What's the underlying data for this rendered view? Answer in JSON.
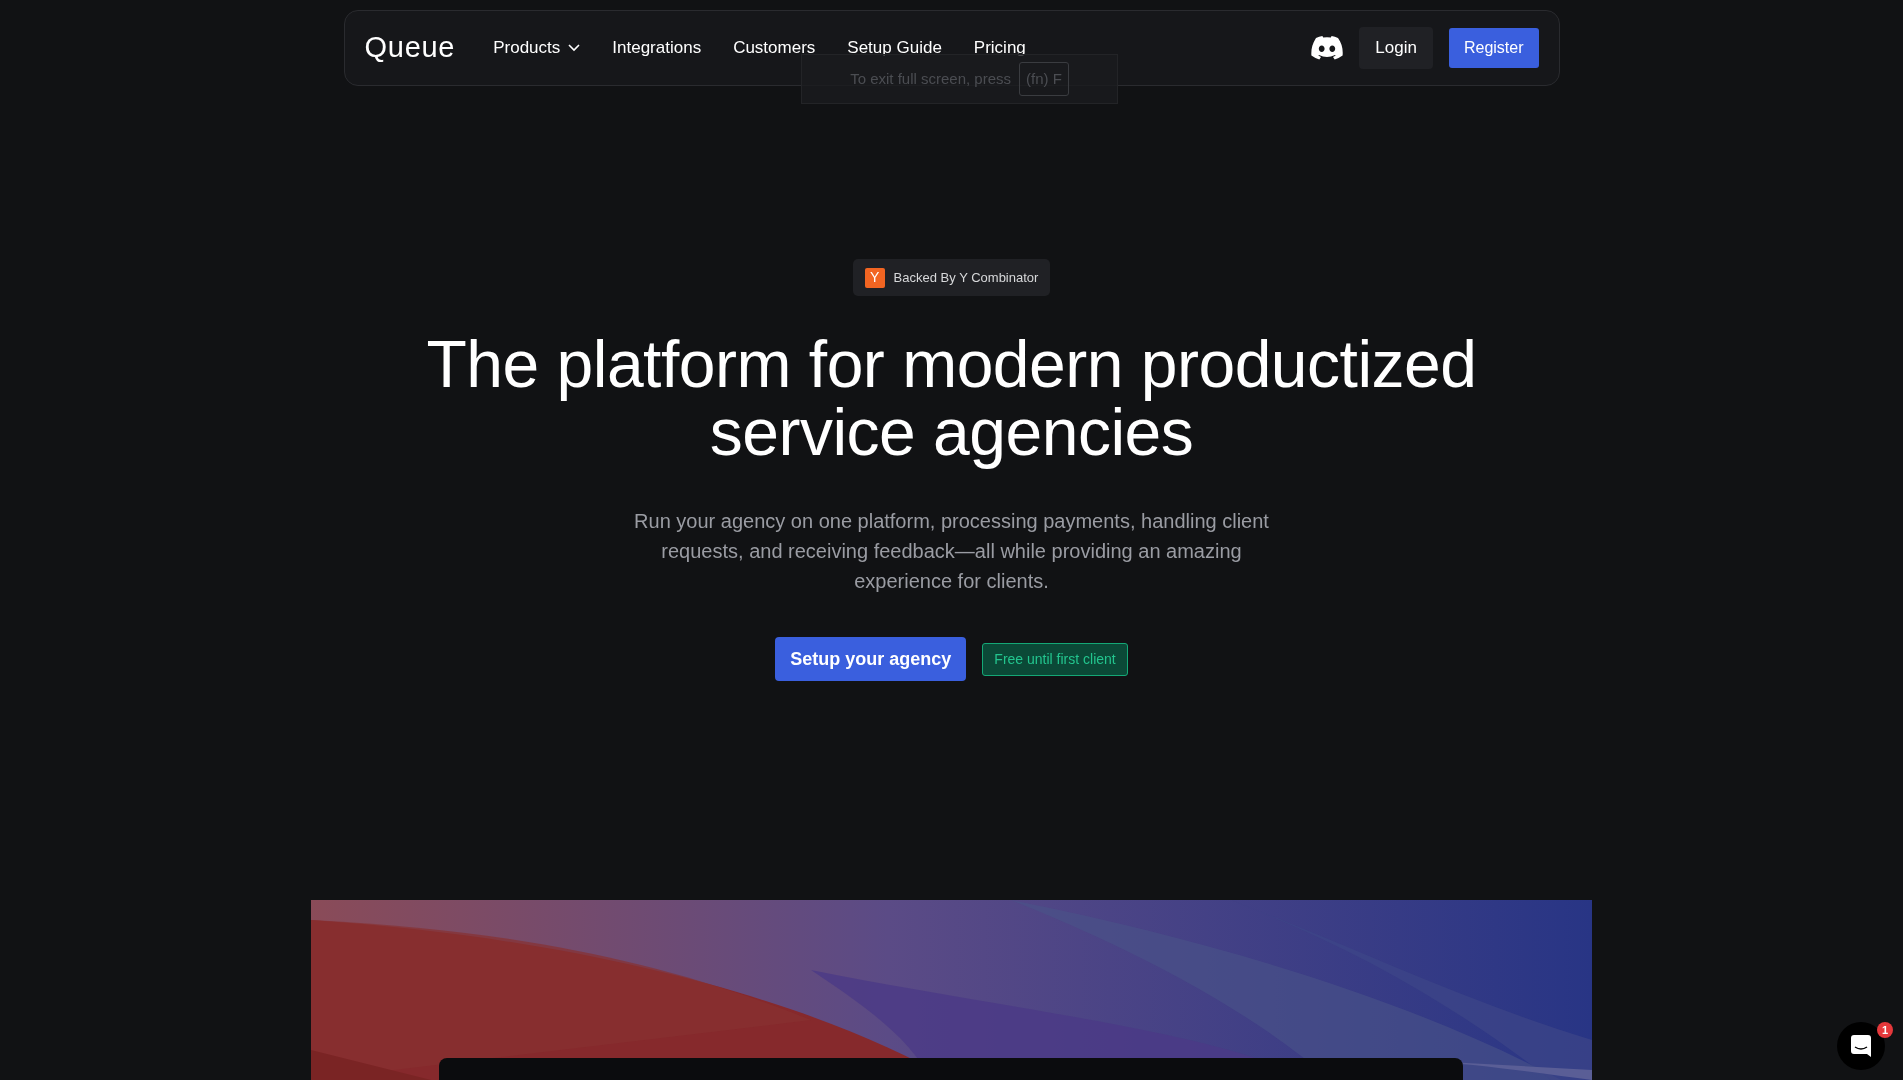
{
  "nav": {
    "logo": "Queue",
    "links": [
      {
        "label": "Products",
        "dropdown": true
      },
      {
        "label": "Integrations",
        "dropdown": false
      },
      {
        "label": "Customers",
        "dropdown": false
      },
      {
        "label": "Setup Guide",
        "dropdown": false
      },
      {
        "label": "Pricing",
        "dropdown": false
      }
    ],
    "login": "Login",
    "register": "Register"
  },
  "fullscreen_toast": {
    "text": "To exit full screen, press",
    "key": "(fn) F"
  },
  "hero": {
    "badge": {
      "icon_letter": "Y",
      "text": "Backed By Y Combinator"
    },
    "title": "The platform for modern productized service agencies",
    "subtitle": "Run your agency on one platform, processing payments, handling client requests, and receiving feedback—all while providing an amazing experience for clients.",
    "cta": "Setup your agency",
    "note": "Free until first client"
  },
  "chat": {
    "unread": "1"
  }
}
